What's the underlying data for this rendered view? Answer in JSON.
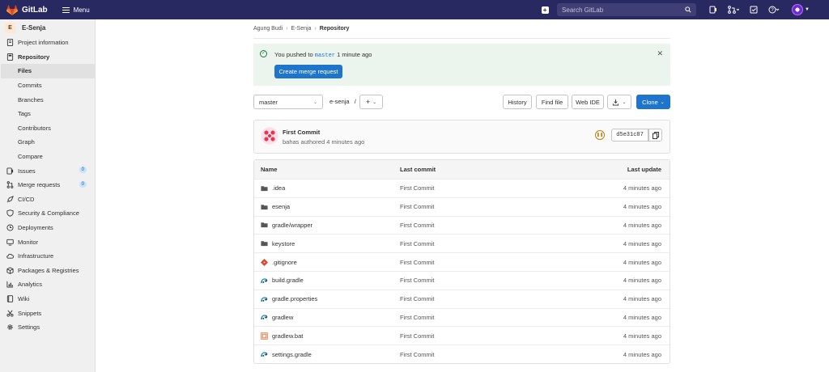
{
  "topbar": {
    "brand": "GitLab",
    "menu_label": "Menu",
    "search_placeholder": "Search GitLab"
  },
  "sidebar": {
    "project_initial": "E",
    "project_name": "E-Senja",
    "items": [
      {
        "label": "Project information",
        "icon": "info-icon"
      },
      {
        "label": "Repository",
        "icon": "book-icon"
      },
      {
        "label": "Files"
      },
      {
        "label": "Commits"
      },
      {
        "label": "Branches"
      },
      {
        "label": "Tags"
      },
      {
        "label": "Contributors"
      },
      {
        "label": "Graph"
      },
      {
        "label": "Compare"
      },
      {
        "label": "Issues",
        "icon": "issues-icon",
        "badge": "0"
      },
      {
        "label": "Merge requests",
        "icon": "merge-request-icon",
        "badge": "0"
      },
      {
        "label": "CI/CD",
        "icon": "rocket-icon"
      },
      {
        "label": "Security & Compliance",
        "icon": "shield-icon"
      },
      {
        "label": "Deployments",
        "icon": "deployments-icon"
      },
      {
        "label": "Monitor",
        "icon": "monitor-icon"
      },
      {
        "label": "Infrastructure",
        "icon": "cloud-icon"
      },
      {
        "label": "Packages & Registries",
        "icon": "package-icon"
      },
      {
        "label": "Analytics",
        "icon": "chart-icon"
      },
      {
        "label": "Wiki",
        "icon": "wiki-icon"
      },
      {
        "label": "Snippets",
        "icon": "scissors-icon"
      },
      {
        "label": "Settings",
        "icon": "gear-icon"
      }
    ]
  },
  "breadcrumb": {
    "items": [
      "Agung Budi",
      "E-Senja",
      "Repository"
    ]
  },
  "alert": {
    "prefix": "You pushed to",
    "branch": "master",
    "suffix": "1 minute ago",
    "button": "Create merge request"
  },
  "toolbar": {
    "branch": "master",
    "path": "e-senja",
    "path_sep": "/",
    "history": "History",
    "find_file": "Find file",
    "web_ide": "Web IDE",
    "clone": "Clone"
  },
  "commit": {
    "title": "First Commit",
    "meta": "bahas authored 4 minutes ago",
    "sha": "d5e31c87"
  },
  "table": {
    "headers": [
      "Name",
      "Last commit",
      "Last update"
    ],
    "rows": [
      {
        "name": ".idea",
        "type": "folder",
        "commit": "First Commit",
        "updated": "4 minutes ago"
      },
      {
        "name": "esenja",
        "type": "folder",
        "commit": "First Commit",
        "updated": "4 minutes ago"
      },
      {
        "name": "gradle/wrapper",
        "type": "folder",
        "commit": "First Commit",
        "updated": "4 minutes ago"
      },
      {
        "name": "keystore",
        "type": "folder",
        "commit": "First Commit",
        "updated": "4 minutes ago"
      },
      {
        "name": ".gitignore",
        "type": "git",
        "commit": "First Commit",
        "updated": "4 minutes ago"
      },
      {
        "name": "build.gradle",
        "type": "gradle",
        "commit": "First Commit",
        "updated": "4 minutes ago"
      },
      {
        "name": "gradle.properties",
        "type": "gradle",
        "commit": "First Commit",
        "updated": "4 minutes ago"
      },
      {
        "name": "gradlew",
        "type": "gradle",
        "commit": "First Commit",
        "updated": "4 minutes ago"
      },
      {
        "name": "gradlew.bat",
        "type": "bat",
        "commit": "First Commit",
        "updated": "4 minutes ago"
      },
      {
        "name": "settings.gradle",
        "type": "gradle",
        "commit": "First Commit",
        "updated": "4 minutes ago"
      }
    ]
  },
  "colors": {
    "topbar": "#292961",
    "accent": "#1f75cb",
    "alert_bg": "#ecf4ee",
    "success": "#217645"
  }
}
